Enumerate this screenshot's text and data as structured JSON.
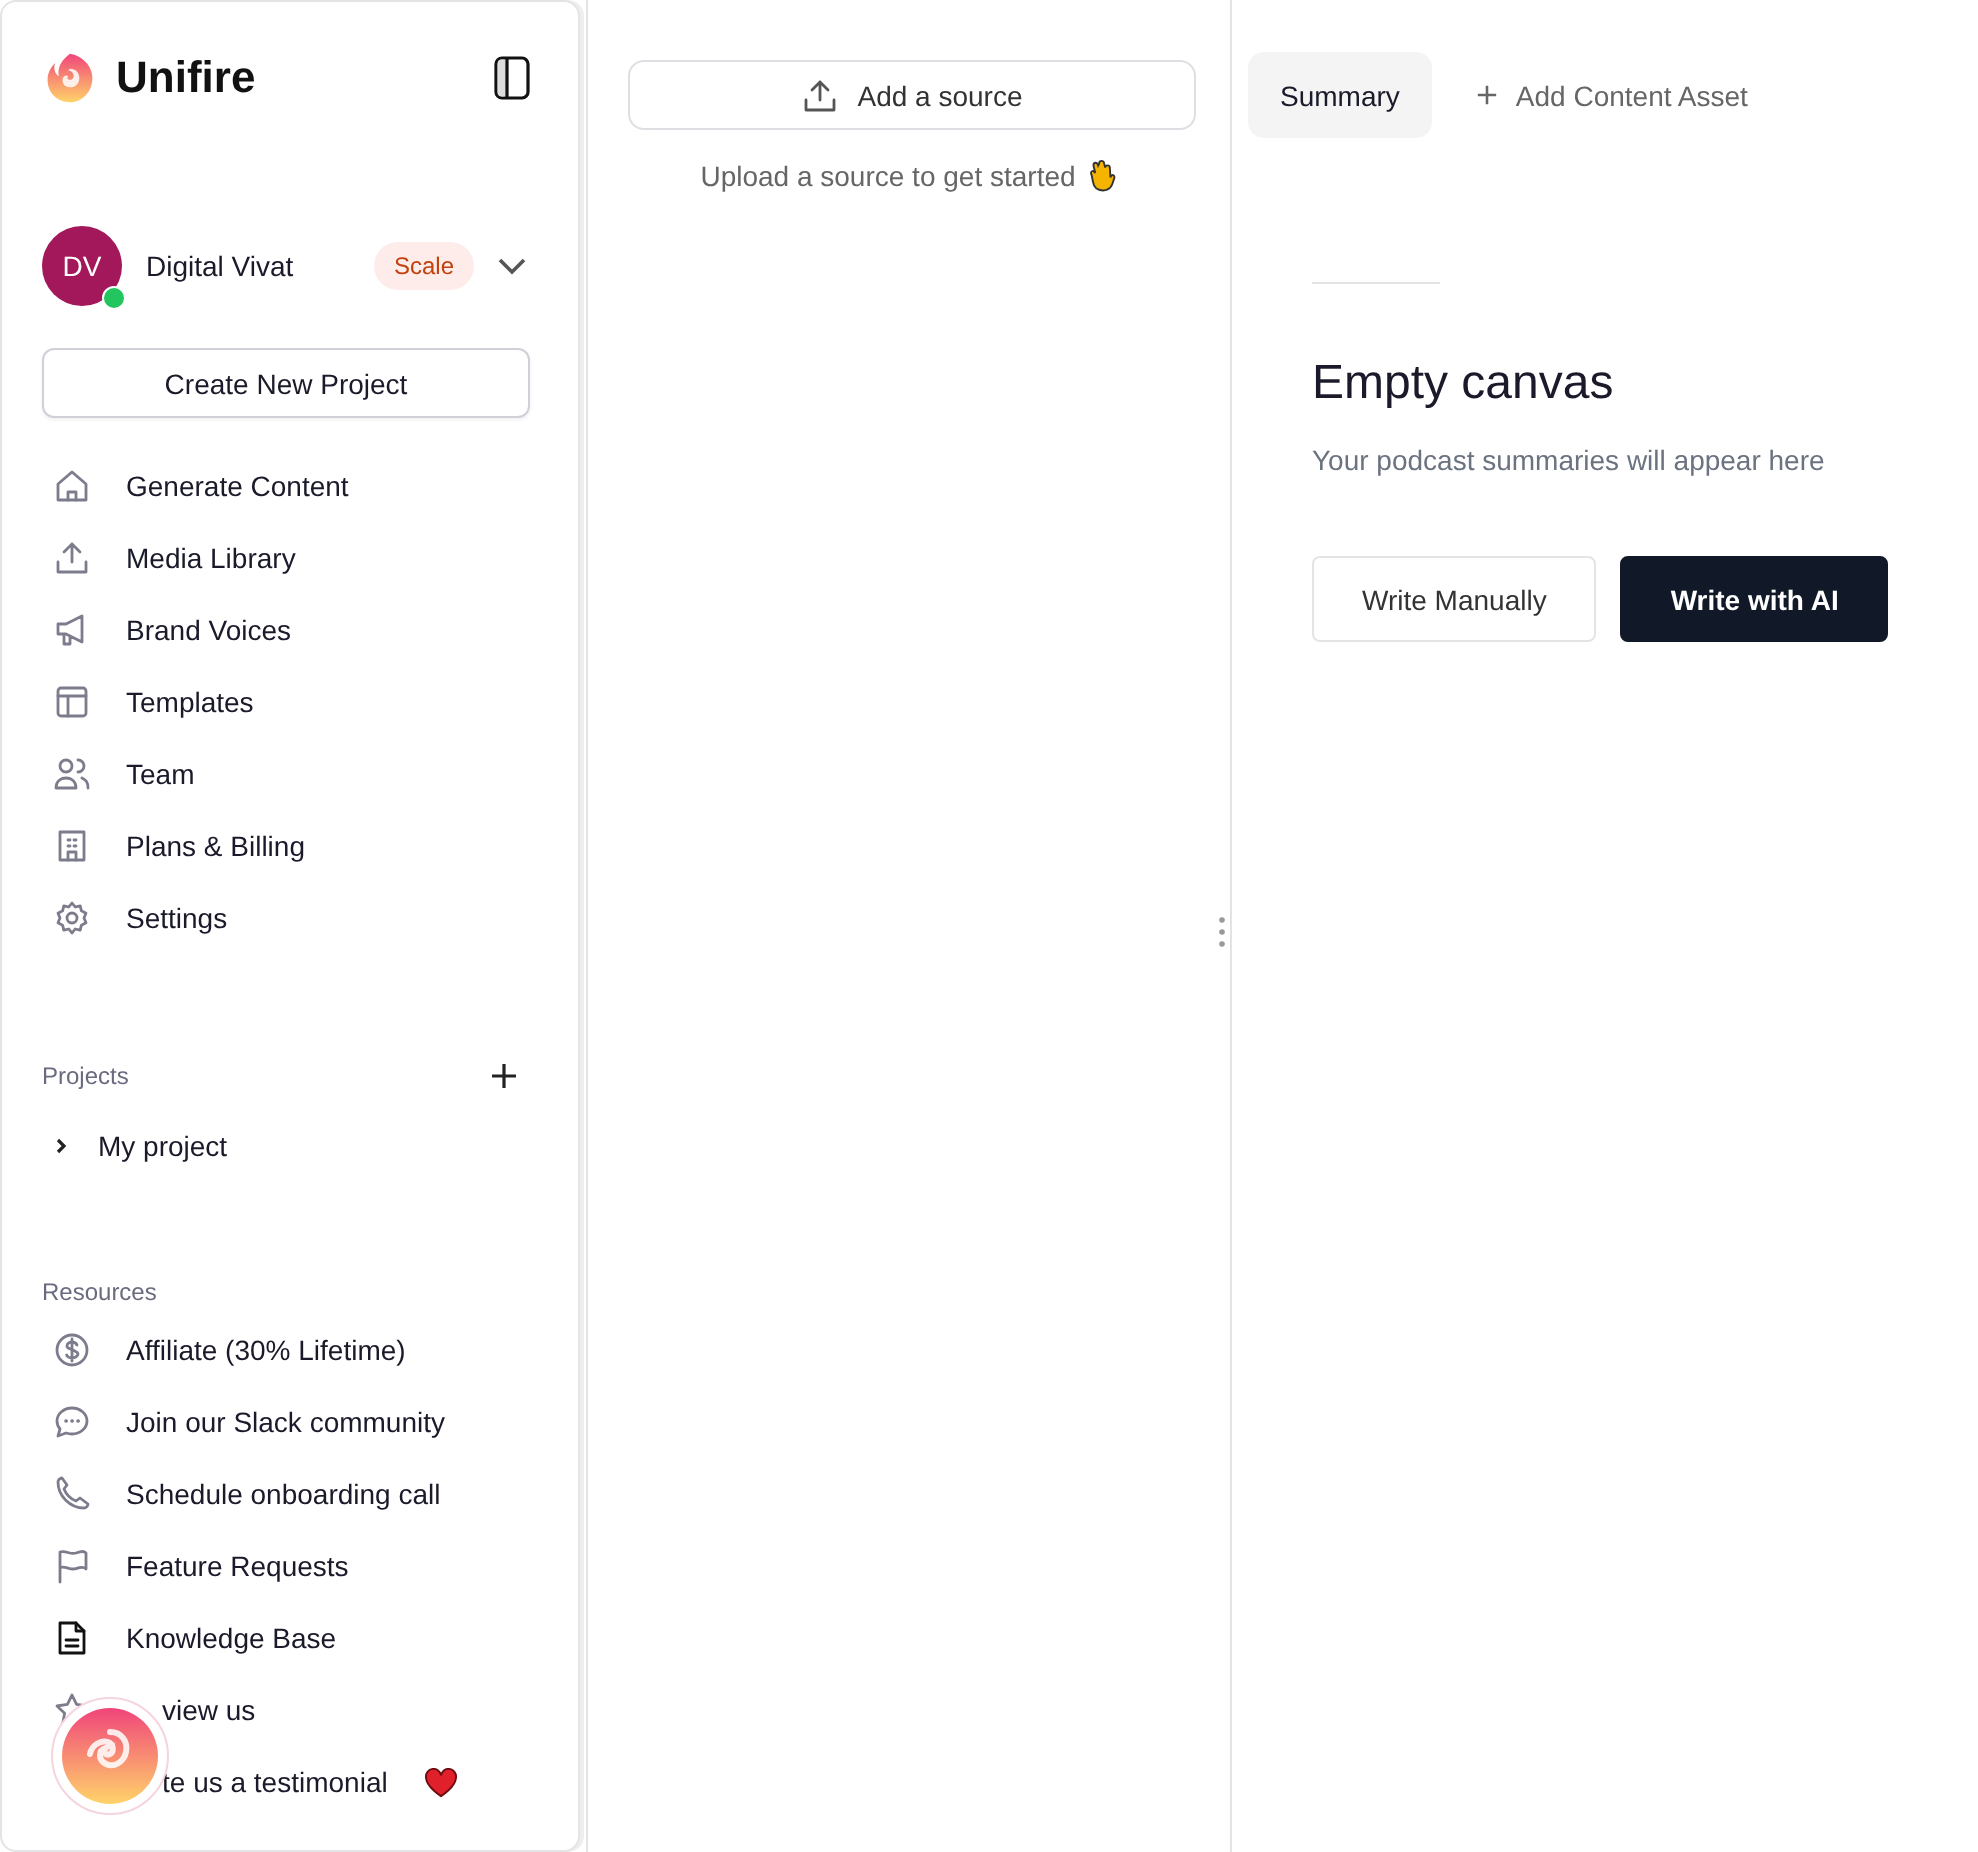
{
  "sidebar": {
    "brand": "Unifire",
    "account": {
      "initials": "DV",
      "name": "Digital Vivat",
      "plan": "Scale",
      "online": true
    },
    "create_button": "Create New Project",
    "nav": [
      {
        "label": "Generate Content"
      },
      {
        "label": "Media Library"
      },
      {
        "label": "Brand Voices"
      },
      {
        "label": "Templates"
      },
      {
        "label": "Team"
      },
      {
        "label": "Plans & Billing"
      },
      {
        "label": "Settings"
      }
    ],
    "projects": {
      "title": "Projects",
      "items": [
        {
          "label": "My project",
          "expanded": false
        }
      ]
    },
    "resources": {
      "title": "Resources",
      "items": [
        {
          "label": "Affiliate (30% Lifetime)",
          "kind": "plain"
        },
        {
          "label": "Join our Slack community",
          "kind": "plain"
        },
        {
          "label": "Schedule onboarding call",
          "kind": "plain"
        },
        {
          "label": "Feature Requests",
          "kind": "plain"
        },
        {
          "label": "Knowledge Base",
          "kind": "plain"
        },
        {
          "label": "view us",
          "kind": "covered"
        },
        {
          "label": "te us a testimonial",
          "kind": "covered",
          "heart": true
        }
      ]
    }
  },
  "sources": {
    "add_button": "Add a source",
    "hint": "Upload a source to get started"
  },
  "tabs": [
    {
      "label": "Summary",
      "selected": true,
      "kind": "tab"
    },
    {
      "label": "Add Content Asset",
      "selected": false,
      "kind": "add"
    }
  ],
  "canvas": {
    "title": "Empty canvas",
    "subtitle": "Your podcast summaries will appear here",
    "buttons": [
      {
        "label": "Write Manually",
        "primary": false
      },
      {
        "label": "Write with AI",
        "primary": true
      }
    ]
  }
}
